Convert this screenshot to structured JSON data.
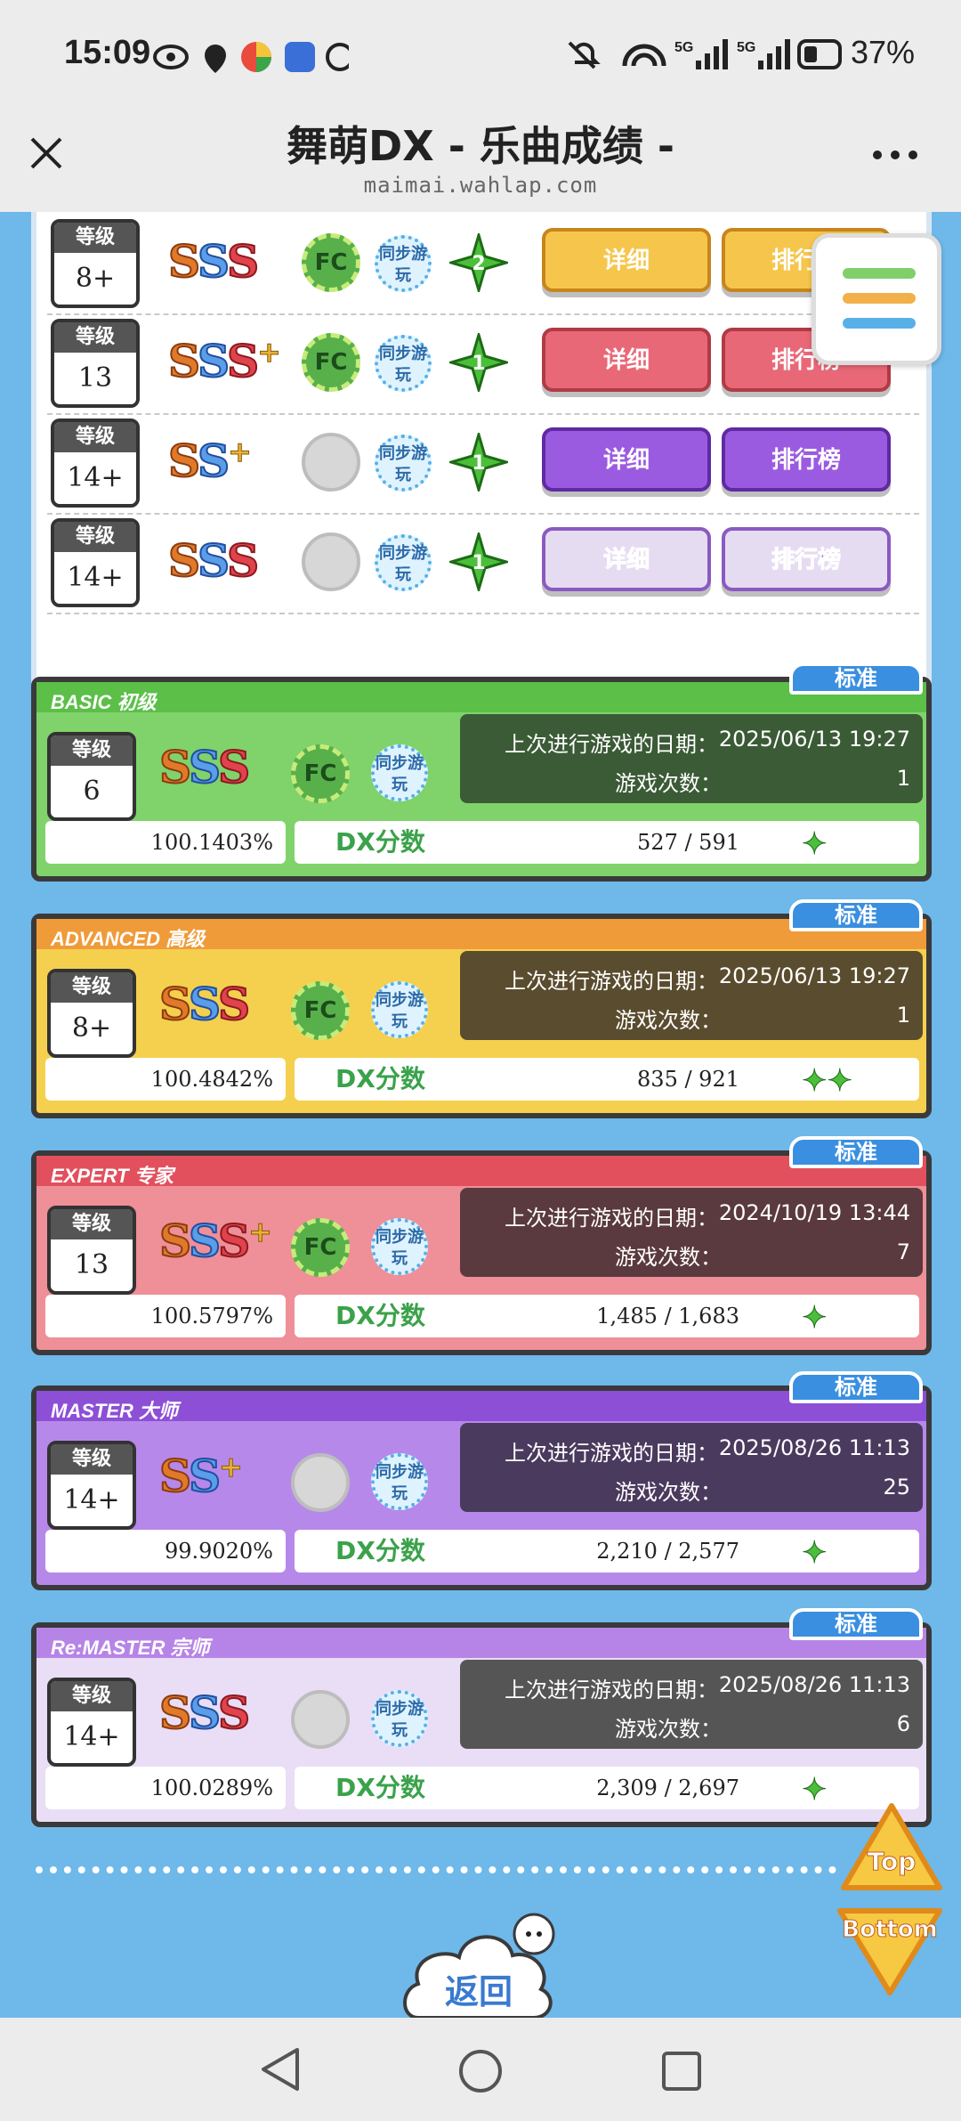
{
  "status_bar": {
    "time": "15:09",
    "battery": "37%",
    "network": "5G"
  },
  "header": {
    "title": "舞萌DX - 乐曲成绩 -",
    "url": "maimai.wahlap.com",
    "close_icon": "close-icon",
    "more_icon": "more-icon"
  },
  "score_rows": [
    {
      "level_label": "等级",
      "level": "8+",
      "rank": "SSS",
      "plus": "",
      "fc": "FC",
      "sync": "同步游玩",
      "dx_stars": "2",
      "btn_detail": "详细",
      "btn_rank": "排行榜",
      "color": "yellow"
    },
    {
      "level_label": "等级",
      "level": "13",
      "rank": "SSS",
      "plus": "+",
      "fc": "FC",
      "sync": "同步游玩",
      "dx_stars": "1",
      "btn_detail": "详细",
      "btn_rank": "排行榜",
      "color": "red"
    },
    {
      "level_label": "等级",
      "level": "14+",
      "rank": "SS",
      "plus": "+",
      "fc": "",
      "sync": "同步游玩",
      "dx_stars": "1",
      "btn_detail": "详细",
      "btn_rank": "排行榜",
      "color": "purple"
    },
    {
      "level_label": "等级",
      "level": "14+",
      "rank": "SSS",
      "plus": "",
      "fc": "",
      "sync": "同步游玩",
      "dx_stars": "1",
      "btn_detail": "详细",
      "btn_rank": "排行榜",
      "color": "lightpurple"
    }
  ],
  "cards": [
    {
      "tag": "标准",
      "label": "BASIC 初级",
      "level_label": "等级",
      "level": "6",
      "rank": "SSS",
      "plus": "",
      "fc": "FC",
      "sync": "同步游玩",
      "last_play_label": "上次进行游戏的日期：",
      "last_play": "2025/06/13 19:27",
      "count_label": "游戏次数：",
      "count": "1",
      "accuracy": "100.1403%",
      "dx_label": "DX分数",
      "dx_score": "527 / 591",
      "dx_stars": "✦",
      "bg": "#7fd36a",
      "head": "#5bbf48",
      "info_bg": "#3b5a36"
    },
    {
      "tag": "标准",
      "label": "ADVANCED 高级",
      "level_label": "等级",
      "level": "8+",
      "rank": "SSS",
      "plus": "",
      "fc": "FC",
      "sync": "同步游玩",
      "last_play_label": "上次进行游戏的日期：",
      "last_play": "2025/06/13 19:27",
      "count_label": "游戏次数：",
      "count": "1",
      "accuracy": "100.4842%",
      "dx_label": "DX分数",
      "dx_score": "835 / 921",
      "dx_stars": "✦✦",
      "bg": "#f4d04e",
      "head": "#ef9b3a",
      "info_bg": "#5a4c2e"
    },
    {
      "tag": "标准",
      "label": "EXPERT 专家",
      "level_label": "等级",
      "level": "13",
      "rank": "SSS",
      "plus": "+",
      "fc": "FC",
      "sync": "同步游玩",
      "last_play_label": "上次进行游戏的日期：",
      "last_play": "2024/10/19 13:44",
      "count_label": "游戏次数：",
      "count": "7",
      "accuracy": "100.5797%",
      "dx_label": "DX分数",
      "dx_score": "1,485 / 1,683",
      "dx_stars": "✦",
      "bg": "#ef8f98",
      "head": "#e2505e",
      "info_bg": "#5a3a3e"
    },
    {
      "tag": "标准",
      "label": "MASTER 大师",
      "level_label": "等级",
      "level": "14+",
      "rank": "SS",
      "plus": "+",
      "fc": "",
      "sync": "同步游玩",
      "last_play_label": "上次进行游戏的日期：",
      "last_play": "2025/08/26 11:13",
      "count_label": "游戏次数：",
      "count": "25",
      "accuracy": "99.9020%",
      "dx_label": "DX分数",
      "dx_score": "2,210 / 2,577",
      "dx_stars": "✦",
      "bg": "#b688ea",
      "head": "#8d4fd6",
      "info_bg": "#4a3a5e"
    },
    {
      "tag": "标准",
      "label": "Re:MASTER 宗师",
      "level_label": "等级",
      "level": "14+",
      "rank": "SSS",
      "plus": "",
      "fc": "",
      "sync": "同步游玩",
      "last_play_label": "上次进行游戏的日期：",
      "last_play": "2025/08/26 11:13",
      "count_label": "游戏次数：",
      "count": "6",
      "accuracy": "100.0289%",
      "dx_label": "DX分数",
      "dx_score": "2,309 / 2,697",
      "dx_stars": "✦",
      "bg": "#e9def6",
      "head": "#b684e6",
      "info_bg": "#555555"
    }
  ],
  "floating": {
    "top_label": "Top",
    "bottom_label": "Bottom",
    "back_label": "返回",
    "menu_icon": "menu-icon"
  },
  "colors": {
    "page_bg": "#6eb8ea",
    "tag_blue": "#3a8fe0",
    "dx_green": "#3aa24a"
  }
}
